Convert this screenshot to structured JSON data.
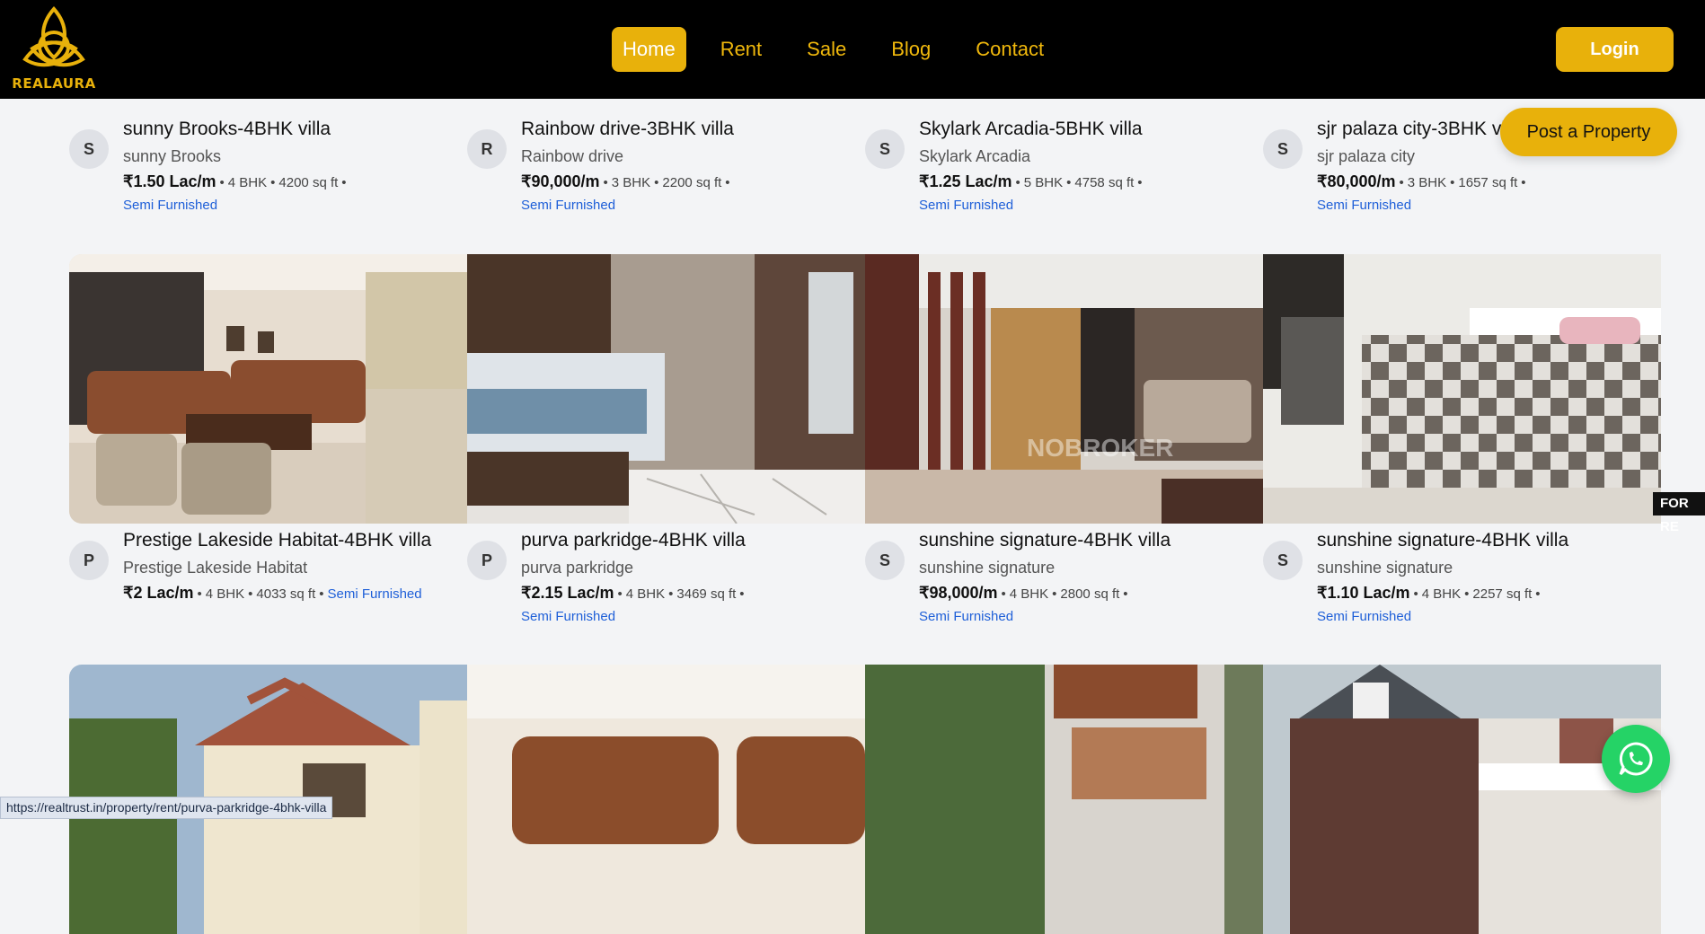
{
  "brand": {
    "name": "REALAURA",
    "accent": "#e8b10b"
  },
  "nav": {
    "items": [
      "Home",
      "Rent",
      "Sale",
      "Blog",
      "Contact"
    ],
    "active": "Home"
  },
  "header": {
    "login_label": "Login"
  },
  "post_property_label": "Post a Property",
  "listings": [
    {
      "initial": "S",
      "title": "sunny Brooks-4BHK villa",
      "location": "sunny Brooks",
      "price": "₹1.50 Lac/m",
      "bhk": "4 BHK",
      "area": "4200 sq ft",
      "furnishing": "Semi Furnished"
    },
    {
      "initial": "R",
      "title": "Rainbow drive-3BHK villa",
      "location": "Rainbow drive",
      "price": "₹90,000/m",
      "bhk": "3 BHK",
      "area": "2200 sq ft",
      "furnishing": "Semi Furnished"
    },
    {
      "initial": "S",
      "title": "Skylark Arcadia-5BHK villa",
      "location": "Skylark Arcadia",
      "price": "₹1.25 Lac/m",
      "bhk": "5 BHK",
      "area": "4758 sq ft",
      "furnishing": "Semi Furnished"
    },
    {
      "initial": "S",
      "title": "sjr palaza city-3BHK villa",
      "location": "sjr palaza city",
      "price": "₹80,000/m",
      "bhk": "3 BHK",
      "area": "1657 sq ft",
      "furnishing": "Semi Furnished"
    },
    {
      "initial": "P",
      "title": "Prestige Lakeside Habitat-4BHK villa",
      "location": "Prestige Lakeside Habitat",
      "price": "₹2 Lac/m",
      "bhk": "4 BHK",
      "area": "4033 sq ft",
      "furnishing": "Semi Furnished"
    },
    {
      "initial": "P",
      "title": "purva parkridge-4BHK villa",
      "location": "purva parkridge",
      "price": "₹2.15 Lac/m",
      "bhk": "4 BHK",
      "area": "3469 sq ft",
      "furnishing": "Semi Furnished"
    },
    {
      "initial": "S",
      "title": "sunshine signature-4BHK villa",
      "location": "sunshine signature",
      "price": "₹98,000/m",
      "bhk": "4 BHK",
      "area": "2800 sq ft",
      "furnishing": "Semi Furnished"
    },
    {
      "initial": "S",
      "title": "sunshine signature-4BHK villa",
      "location": "sunshine signature",
      "price": "₹1.10 Lac/m",
      "bhk": "4 BHK",
      "area": "2257 sq ft",
      "furnishing": "Semi Furnished"
    }
  ],
  "badge": {
    "for_rent": "FOR RE"
  },
  "watermark": "NOBROKER",
  "status_bar": {
    "url": "https://realtrust.in/property/rent/purva-parkridge-4bhk-villa"
  },
  "colors": {
    "link_blue": "#1e5fd8",
    "whatsapp_green": "#25d366"
  }
}
